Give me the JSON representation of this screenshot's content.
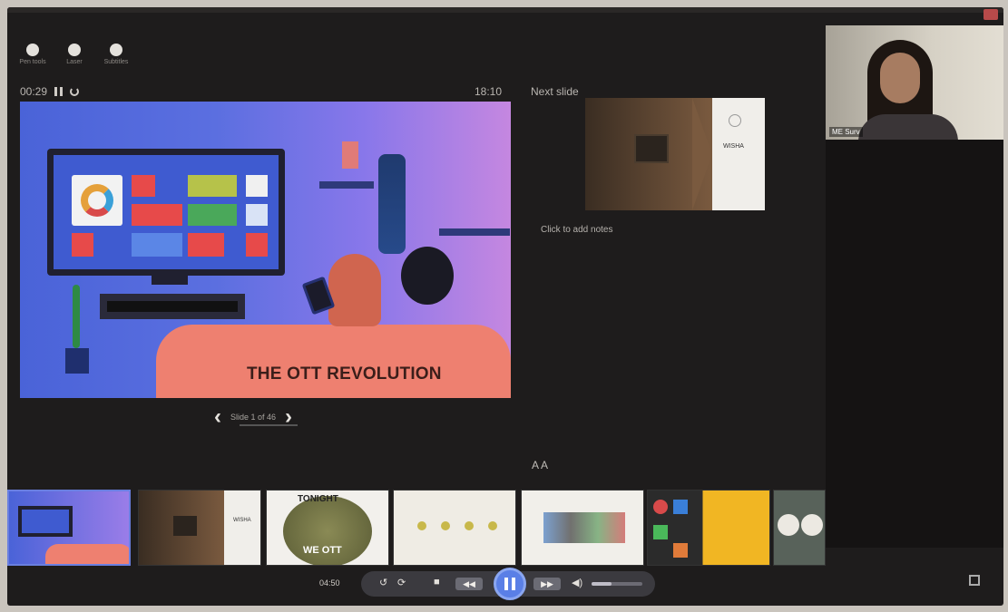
{
  "tools": [
    {
      "icon": "pen-icon",
      "label": "Pen tools"
    },
    {
      "icon": "laser-icon",
      "label": "Laser"
    },
    {
      "icon": "subtitle-icon",
      "label": "Subtitles"
    }
  ],
  "presenter": {
    "elapsed": "00:29",
    "clock": "18:10",
    "next_slide_label": "Next slide",
    "notes_placeholder": "Click to add notes",
    "slide_counter": "Slide 1 of 46",
    "zoom_label": "A A"
  },
  "current_slide": {
    "title": "THE OTT REVOLUTION"
  },
  "next_slide": {
    "side_text": "WISHA"
  },
  "video": {
    "participant_name": "ME Surv"
  },
  "thumbnails": [
    {
      "id": "t1",
      "theme": "ott-illustration"
    },
    {
      "id": "t2",
      "theme": "retro-tv"
    },
    {
      "id": "t3",
      "theme": "tonight-we-ott",
      "text_top": "TONIGHT",
      "text_bottom": "WE OTT"
    },
    {
      "id": "t4",
      "theme": "icons-row"
    },
    {
      "id": "t5",
      "theme": "diagram"
    },
    {
      "id": "t6",
      "theme": "logos-yellow"
    },
    {
      "id": "t7",
      "theme": "circles"
    }
  ],
  "controls": {
    "time": "04:50",
    "rewind_label": "◀◀",
    "forward_label": "▶▶",
    "volume_level": 0.4
  },
  "colors": {
    "accent": "#5a7fe6",
    "background": "#1e1c1c"
  }
}
